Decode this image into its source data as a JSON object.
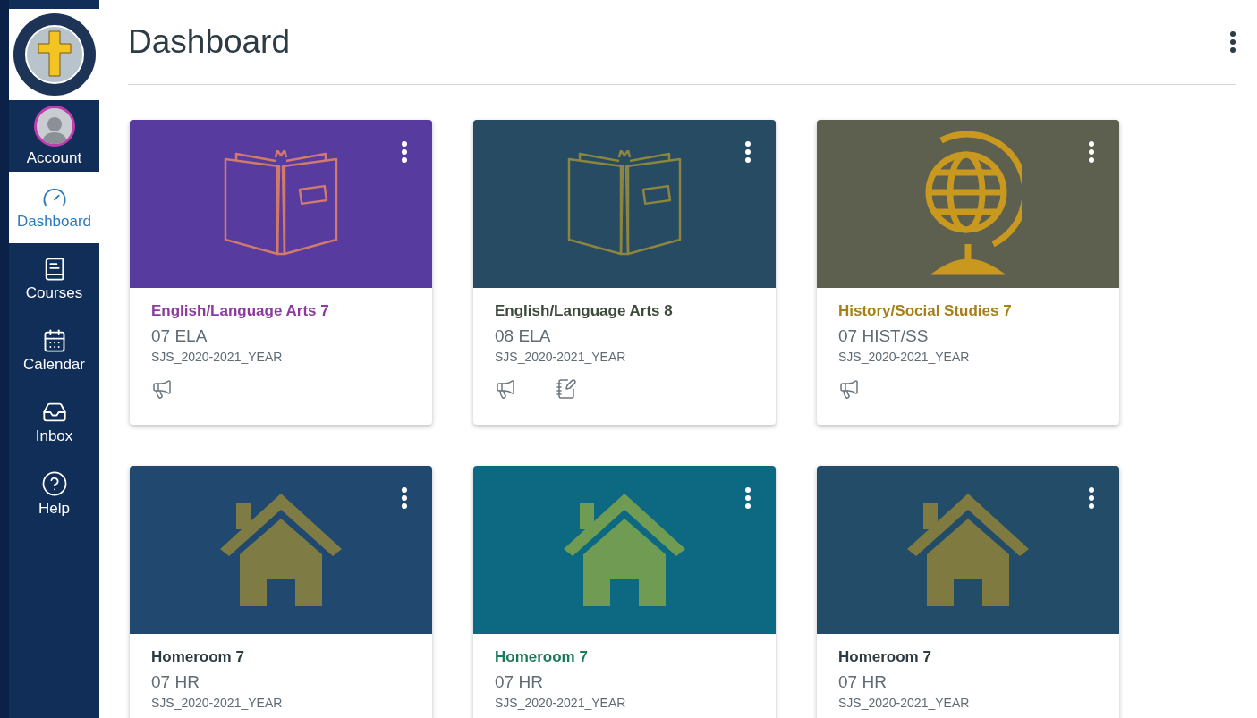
{
  "sidebar": {
    "items": [
      {
        "kind": "account",
        "label": "Account",
        "selected": false
      },
      {
        "kind": "dashboard",
        "label": "Dashboard",
        "selected": true
      },
      {
        "kind": "courses",
        "label": "Courses",
        "selected": false
      },
      {
        "kind": "calendar",
        "label": "Calendar",
        "selected": false
      },
      {
        "kind": "inbox",
        "label": "Inbox",
        "selected": false
      },
      {
        "kind": "help",
        "label": "Help",
        "selected": false
      }
    ]
  },
  "header": {
    "title": "Dashboard"
  },
  "cards": [
    {
      "banner": {
        "color": "#573b9f",
        "art": {
          "kind": "book",
          "color": "#d17a6c"
        }
      },
      "title": {
        "text": "English/Language Arts 7",
        "color": "#8d3aa0"
      },
      "code": "07 ELA",
      "term": "SJS_2020-2021_YEAR",
      "actions": [
        {
          "kind": "announcements"
        }
      ]
    },
    {
      "banner": {
        "color": "#264b62",
        "art": {
          "kind": "book",
          "color": "#8b8540"
        }
      },
      "title": {
        "text": "English/Language Arts 8",
        "color": "#3c4a3a"
      },
      "code": "08 ELA",
      "term": "SJS_2020-2021_YEAR",
      "actions": [
        {
          "kind": "announcements"
        },
        {
          "kind": "assignments"
        }
      ]
    },
    {
      "banner": {
        "color": "#5e604f",
        "art": {
          "kind": "globe",
          "color": "#c8981f"
        }
      },
      "title": {
        "text": "History/Social Studies 7",
        "color": "#a67f17"
      },
      "code": "07 HIST/SS",
      "term": "SJS_2020-2021_YEAR",
      "actions": [
        {
          "kind": "announcements"
        }
      ]
    },
    {
      "banner": {
        "color": "#21486e",
        "art": {
          "kind": "house",
          "color": "#7f7b44"
        }
      },
      "title": {
        "text": "Homeroom 7",
        "color": "#2d3b45"
      },
      "code": "07 HR",
      "term": "SJS_2020-2021_YEAR"
    },
    {
      "banner": {
        "color": "#0d6882",
        "art": {
          "kind": "house",
          "color": "#6f9b52"
        }
      },
      "title": {
        "text": "Homeroom 7",
        "color": "#1c7a5c"
      },
      "code": "07 HR",
      "term": "SJS_2020-2021_YEAR"
    },
    {
      "banner": {
        "color": "#234c68",
        "art": {
          "kind": "house",
          "color": "#7e7a40"
        }
      },
      "title": {
        "text": "Homeroom 7",
        "color": "#2d3b45"
      },
      "code": "07 HR",
      "term": "SJS_2020-2021_YEAR"
    }
  ]
}
